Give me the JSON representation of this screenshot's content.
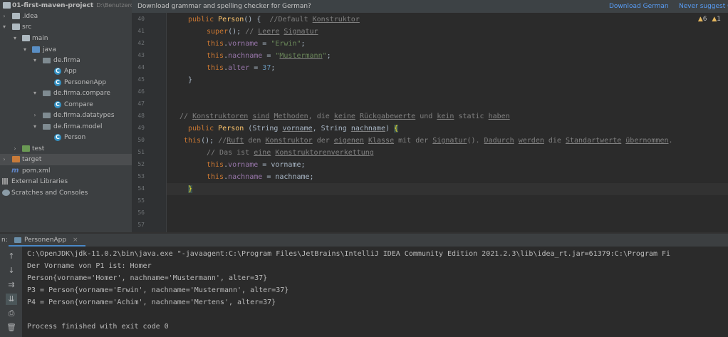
{
  "project_tree": {
    "root": {
      "label": "01-first-maven-project",
      "path": "D:\\Benutzerdi"
    },
    "items": [
      {
        "label": "idea",
        "display": ".idea"
      },
      {
        "label": "src"
      },
      {
        "label": "main"
      },
      {
        "label": "java"
      },
      {
        "label": "de.firma"
      },
      {
        "label": "App"
      },
      {
        "label": "PersonenApp"
      },
      {
        "label": "de.firma.compare"
      },
      {
        "label": "Compare"
      },
      {
        "label": "de.firma.datatypes"
      },
      {
        "label": "de.firma.model"
      },
      {
        "label": "Person"
      },
      {
        "label": "test"
      },
      {
        "label": "target"
      },
      {
        "label": "pom.xml"
      },
      {
        "label": "External Libraries"
      },
      {
        "label": "Scratches and Consoles"
      }
    ]
  },
  "notification": {
    "message": "Download grammar and spelling checker for German?",
    "action_download": "Download German",
    "action_never": "Never suggest G"
  },
  "inspections": {
    "warnings": "6",
    "weak_warnings": "1"
  },
  "editor": {
    "line_numbers": [
      "40",
      "41",
      "42",
      "43",
      "44",
      "45",
      "46",
      "47",
      "48",
      "49",
      "50",
      "51",
      "52",
      "53",
      "54",
      "55",
      "56",
      "57"
    ],
    "lines": [
      "public Person() {  //Default Konstruktor",
      "super(); // Leere Signatur",
      "this.vorname = \"Erwin\";",
      "this.nachname = \"Mustermann\";",
      "this.alter = 37;",
      "}",
      "",
      "",
      "// Konstruktoren sind Methoden, die keine Rückgabewerte und kein static haben",
      "public Person (String vorname, String nachname) {",
      "this(); //Ruft den Konstruktor der eigenen Klasse mit der Signatur(). Dadurch werden die Standartwerte übernommen.",
      "// Das ist eine Konstruktorenverkettung",
      "this.vorname = vorname;",
      "this.nachname = nachname;",
      "}",
      "",
      "",
      ""
    ]
  },
  "run_panel": {
    "label": "n:",
    "tab_label": "PersonenApp",
    "tab_close": "×",
    "output": [
      "C:\\OpenJDK\\jdk-11.0.2\\bin\\java.exe \"-javaagent:C:\\Program Files\\JetBrains\\IntelliJ IDEA Community Edition 2021.2.3\\lib\\idea_rt.jar=61379:C:\\Program Fi",
      "Der Vorname von P1 ist: Homer",
      "Person{vorname='Homer', nachname='Mustermann', alter=37}",
      "P3 = Person{vorname='Erwin', nachname='Mustermann', alter=37}",
      "P4 = Person{vorname='Achim', nachname='Mertens', alter=37}",
      "",
      "Process finished with exit code 0"
    ]
  },
  "colors": {
    "tree_bg": "#3c3f41",
    "editor_bg": "#2b2b2b",
    "keyword": "#cc7832",
    "string": "#6a8759",
    "field": "#9876aa",
    "comment": "#808080",
    "link": "#589df6"
  }
}
